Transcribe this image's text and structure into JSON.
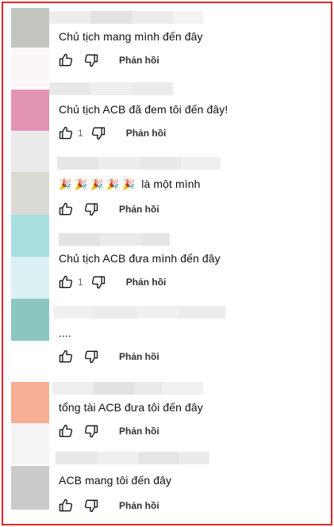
{
  "colors": {
    "frame": "#e0262a",
    "text": "#0f0f0f",
    "muted": "#606060"
  },
  "icons": [
    "thumbs-up-icon",
    "thumbs-down-icon",
    "party-popper-icon"
  ],
  "reply_label": "Phản hồi",
  "comments": [
    {
      "text": "Chủ tịch mang mình đến đây",
      "likes": ""
    },
    {
      "text": "Chủ tịch ACB đã đem tôi đến đây!",
      "likes": "1"
    },
    {
      "text": "là một mình",
      "emojis": "🎉 🎉 🎉 🎉 🎉",
      "likes": ""
    },
    {
      "text": "Chủ tịch ACB đưa mình đến đây",
      "likes": "1"
    },
    {
      "text": "....",
      "likes": ""
    },
    {
      "text": "tổng tài ACB đưa tôi đến đây",
      "likes": ""
    },
    {
      "text": "ACB mang tôi đến đây",
      "likes": ""
    }
  ]
}
